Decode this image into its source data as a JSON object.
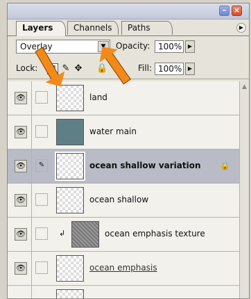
{
  "tabs": [
    "Layers",
    "Channels",
    "Paths"
  ],
  "blend_mode": "Overlay",
  "opacity": {
    "label": "Opacity:",
    "value": "100%"
  },
  "lock_label": "Lock:",
  "fill": {
    "label": "Fill:",
    "value": "100%"
  },
  "layers": [
    {
      "name": "land"
    },
    {
      "name": "water main"
    },
    {
      "name": "ocean shallow variation"
    },
    {
      "name": "ocean shallow"
    },
    {
      "name": "ocean emphasis texture"
    },
    {
      "name": "ocean emphasis"
    }
  ],
  "icons": {
    "eye": "eye-icon",
    "brush": "brush-icon",
    "lock": "padlock-icon",
    "move": "move-icon",
    "clip": "clipping-arrow-icon"
  }
}
